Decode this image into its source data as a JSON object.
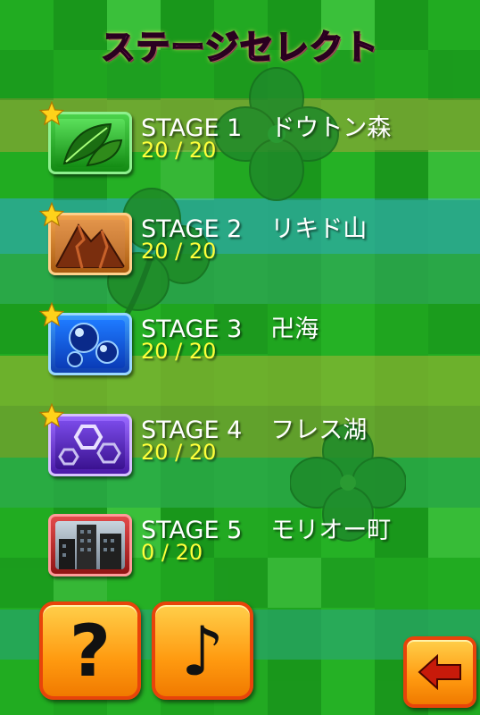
{
  "title": "ステージセレクト",
  "stages": [
    {
      "label": "STAGE 1",
      "name": "ドウトン森",
      "progress": "20 / 20",
      "cleared": true,
      "theme": "leaf"
    },
    {
      "label": "STAGE 2",
      "name": "リキド山",
      "progress": "20 / 20",
      "cleared": true,
      "theme": "mountain"
    },
    {
      "label": "STAGE 3",
      "name": "卍海",
      "progress": "20 / 20",
      "cleared": true,
      "theme": "water"
    },
    {
      "label": "STAGE 4",
      "name": "フレス湖",
      "progress": "20 / 20",
      "cleared": true,
      "theme": "ice"
    },
    {
      "label": "STAGE 5",
      "name": "モリオー町",
      "progress": "0 / 20",
      "cleared": false,
      "theme": "city"
    }
  ],
  "buttons": {
    "help": "?",
    "sound": "♪",
    "back_icon": "left-arrow-icon"
  },
  "colors": {
    "title": "#ff4fb0",
    "progress": "#ffff3a",
    "button": "#ff9a10"
  }
}
